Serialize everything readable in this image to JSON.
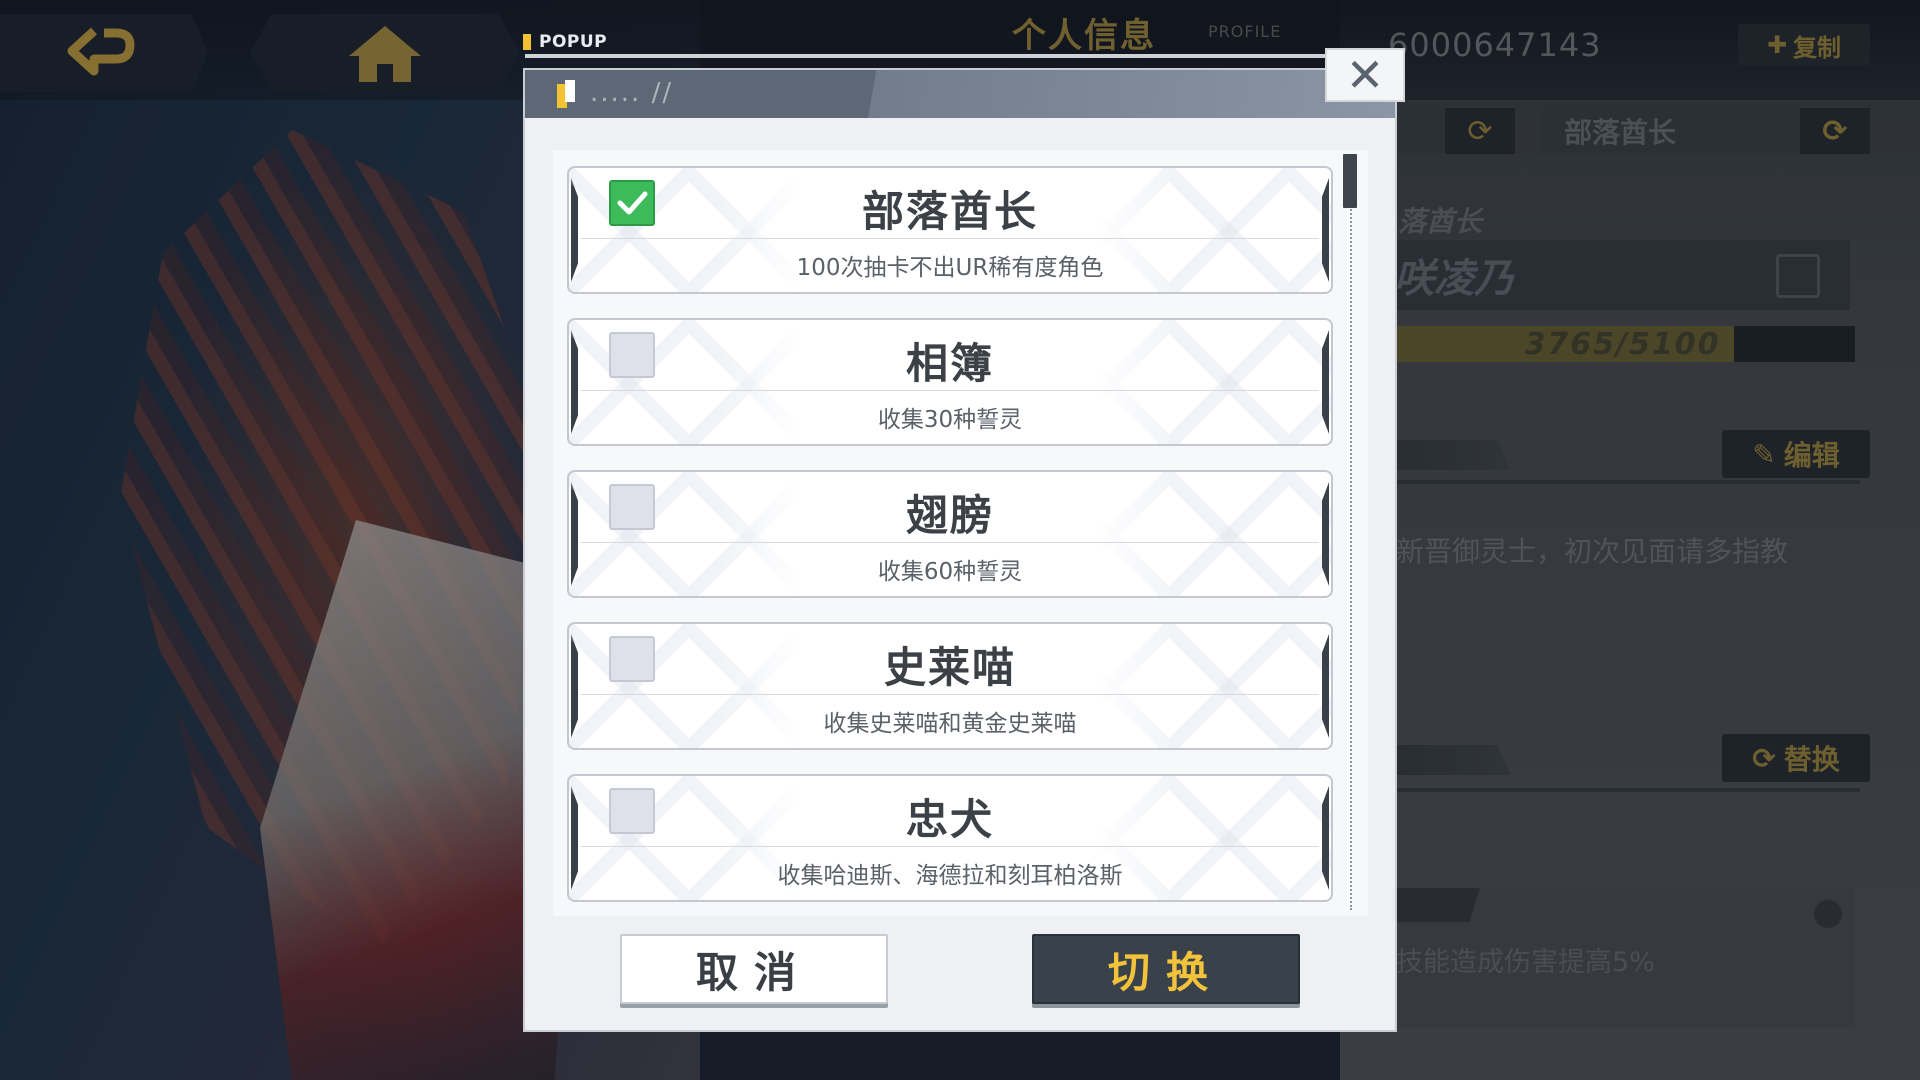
{
  "popup": {
    "tag_label": "POPUP",
    "title": "..... //",
    "close_glyph": "✕",
    "items": [
      {
        "title": "部落酋长",
        "desc": "100次抽卡不出UR稀有度角色",
        "checked": true
      },
      {
        "title": "相簿",
        "desc": "收集30种誓灵",
        "checked": false
      },
      {
        "title": "翅膀",
        "desc": "收集60种誓灵",
        "checked": false
      },
      {
        "title": "史莱喵",
        "desc": "收集史莱喵和黄金史莱喵",
        "checked": false
      },
      {
        "title": "忠犬",
        "desc": "收集哈迪斯、海德拉和刻耳柏洛斯",
        "checked": false
      }
    ],
    "buttons": {
      "cancel": "取消",
      "switch": "切换"
    }
  },
  "background": {
    "header_title": "个人信息",
    "header_subtitle": "PROFILE",
    "uid": "6000647143",
    "copy_label": "复制",
    "title_box": "部落酋长",
    "role_label": "落酋长",
    "name": "咲凌乃",
    "exp_text": "3765/5100",
    "exp_fraction": 0.74,
    "edit_label": "编辑",
    "intro": "新晋御灵士，初次见面请多指教",
    "replace_label": "替换",
    "skill_text": "技能造成伤害提高5%"
  },
  "icons": {
    "back": "back-arrow-icon",
    "home": "home-icon",
    "check": "checkmark-icon",
    "close": "close-icon",
    "swap": "swap-icon",
    "edit": "edit-icon"
  },
  "colors": {
    "accent_gold": "#f2c23a",
    "check_green": "#3dbb5a",
    "dark_button": "#39414b"
  }
}
